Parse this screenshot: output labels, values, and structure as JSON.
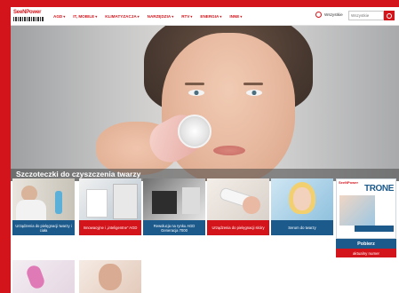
{
  "header": {
    "logo_text": "SeeNPower",
    "menu": [
      {
        "label": "AGD"
      },
      {
        "label": "IT, MOBILE"
      },
      {
        "label": "KLIMATYZACJA"
      },
      {
        "label": "NARZĘDZIA"
      },
      {
        "label": "RTV"
      },
      {
        "label": "ENERGIA"
      },
      {
        "label": "INNE"
      }
    ],
    "account_label": "Wszystkie",
    "search_placeholder": "Wszystkie",
    "accent_color": "#d4141b"
  },
  "hero": {
    "title": "Szczoteczki do czyszczenia twarzy"
  },
  "tiles": [
    {
      "caption": "Urządzenia do pielęgnacji twarzy i ciała",
      "color": "blue"
    },
    {
      "caption": "Innowacyjne i „inteligentne” AGD",
      "color": "red"
    },
    {
      "caption": "Rewolucja na rynku AGD Generacja 7000",
      "color": "blue"
    },
    {
      "caption": "Urządzenia do pielęgnacji skóry",
      "color": "red"
    },
    {
      "caption": "Serum do twarzy",
      "color": "blue"
    },
    {
      "caption": "",
      "color": "none"
    },
    {
      "caption": "",
      "color": "none"
    }
  ],
  "promo": {
    "brand": "SeeNPower",
    "magazine_title": "TRONE",
    "download_label": "Pobierz",
    "issue_label": "aktualny numer"
  },
  "colors": {
    "brand_red": "#d4141b",
    "brand_blue": "#1c5a8c"
  }
}
